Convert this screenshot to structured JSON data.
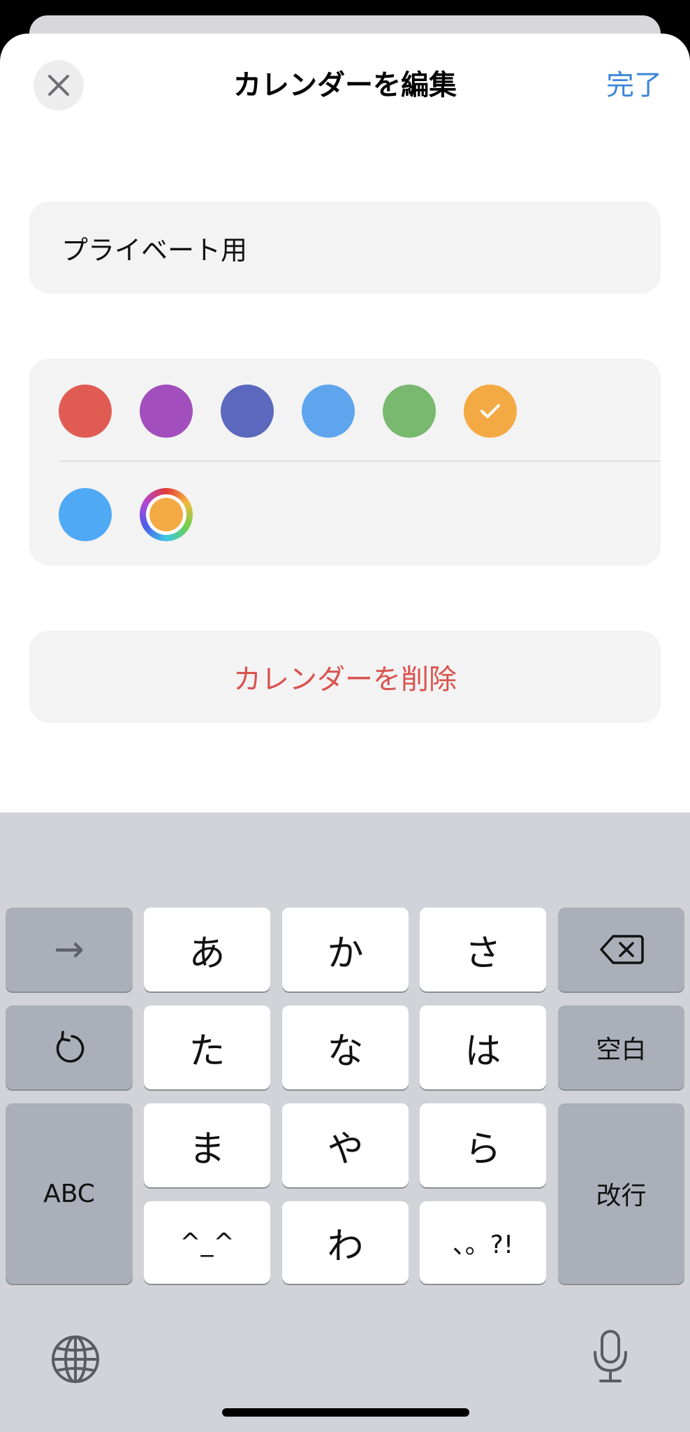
{
  "header": {
    "title": "カレンダーを編集",
    "done_label": "完了"
  },
  "name_field": {
    "value": "プライベート用"
  },
  "colors": {
    "row1": [
      "#e05c53",
      "#a24fbd",
      "#5b68bd",
      "#5fa5ee",
      "#78b86f",
      "#f4aa44"
    ],
    "row2_preset": "#50a9f5",
    "custom_core": "#f4aa44",
    "selected_index": 5
  },
  "delete_label": "カレンダーを削除",
  "keyboard": {
    "row1": [
      "→",
      "あ",
      "か",
      "さ"
    ],
    "row2": [
      "た",
      "な",
      "は",
      "空白"
    ],
    "row3": [
      "ABC",
      "ま",
      "や",
      "ら",
      "改行"
    ],
    "row4": [
      "^_^",
      "わ",
      "、。?!"
    ]
  }
}
